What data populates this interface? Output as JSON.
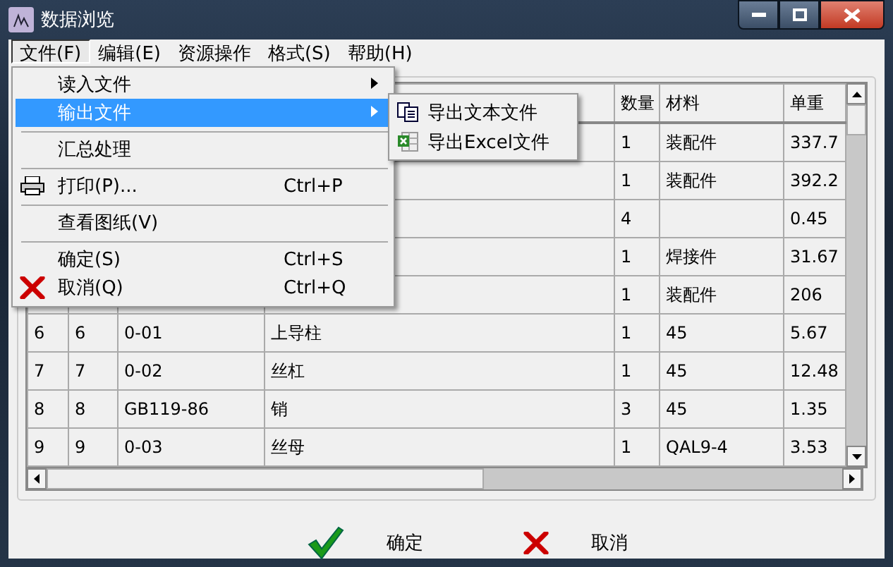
{
  "window": {
    "title": "数据浏览"
  },
  "menubar": [
    {
      "label": "文件(F)",
      "selected": true
    },
    {
      "label": "编辑(E)",
      "selected": false
    },
    {
      "label": "资源操作",
      "selected": false
    },
    {
      "label": "格式(S)",
      "selected": false
    },
    {
      "label": "帮助(H)",
      "selected": false
    }
  ],
  "menu": [
    {
      "kind": "item",
      "label": "读入文件",
      "submenu": true,
      "selected": false
    },
    {
      "kind": "item",
      "label": "输出文件",
      "submenu": true,
      "selected": true
    },
    {
      "kind": "separator"
    },
    {
      "kind": "item",
      "label": "汇总处理",
      "selected": false
    },
    {
      "kind": "separator"
    },
    {
      "kind": "item",
      "label": "打印(P)...",
      "shortcut": "Ctrl+P",
      "selected": false
    },
    {
      "kind": "separator"
    },
    {
      "kind": "item",
      "label": "查看图纸(V)",
      "selected": false
    },
    {
      "kind": "separator"
    },
    {
      "kind": "item",
      "label": "确定(S)",
      "shortcut": "Ctrl+S",
      "selected": false
    },
    {
      "kind": "item",
      "label": "取消(Q)",
      "shortcut": "Ctrl+Q",
      "selected": false
    }
  ],
  "submenu": [
    {
      "label": "导出文本文件"
    },
    {
      "label": "导出Excel文件"
    }
  ],
  "table": {
    "columns": [
      "",
      "",
      "",
      "",
      "数量",
      "材料",
      "单重"
    ],
    "rows": [
      [
        "",
        "",
        "",
        "",
        "1",
        "装配件",
        "337.7"
      ],
      [
        "",
        "",
        "",
        "",
        "1",
        "装配件",
        "392.2"
      ],
      [
        "",
        "",
        "",
        "",
        "4",
        "",
        "0.45"
      ],
      [
        "",
        "",
        "",
        "",
        "1",
        "焊接件",
        "31.67"
      ],
      [
        "",
        "",
        "",
        "",
        "1",
        "装配件",
        "206"
      ],
      [
        "6",
        "6",
        "0-01",
        "上导柱",
        "1",
        "45",
        "5.67"
      ],
      [
        "7",
        "7",
        "0-02",
        "丝杠",
        "1",
        "45",
        "12.48"
      ],
      [
        "8",
        "8",
        "GB119-86",
        "销",
        "3",
        "45",
        "1.35"
      ],
      [
        "9",
        "9",
        "0-03",
        "丝母",
        "1",
        "QAL9-4",
        "3.53"
      ]
    ]
  },
  "buttons": [
    {
      "label": "确定"
    },
    {
      "label": "取消"
    }
  ]
}
